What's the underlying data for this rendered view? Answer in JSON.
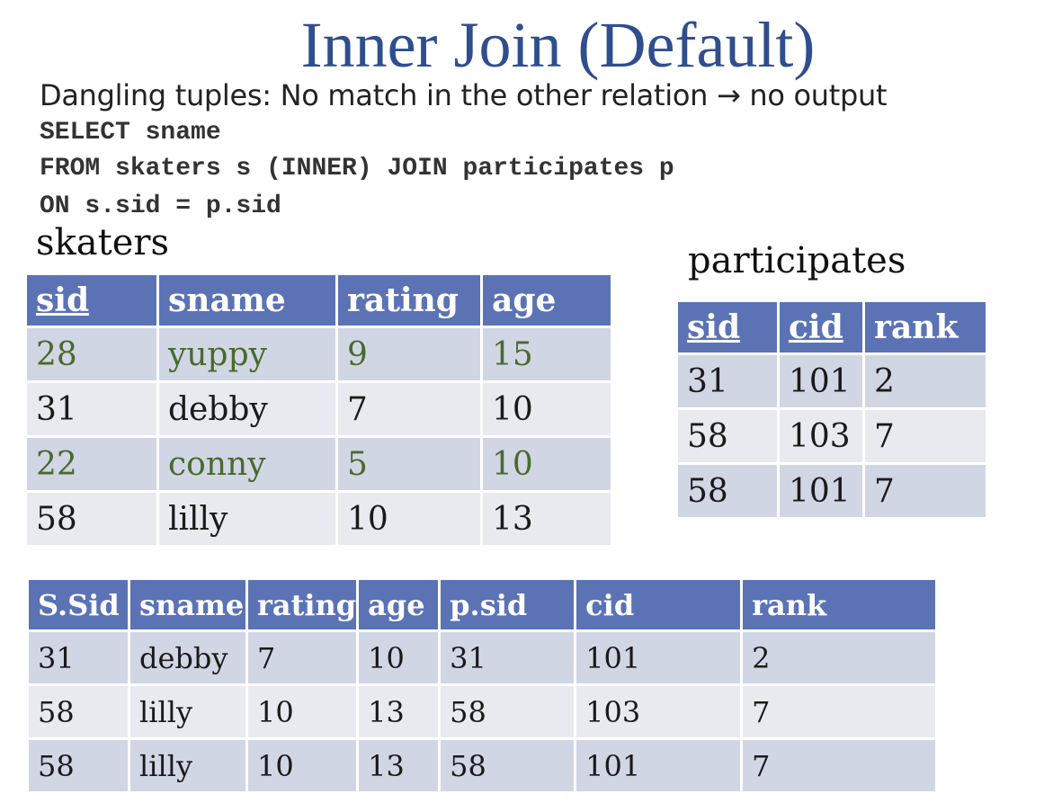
{
  "title": "Inner Join (Default)",
  "dangling_text": "Dangling tuples: No match in the other relation →  no output",
  "sql": [
    "SELECT sname",
    "FROM skaters s (INNER) JOIN participates p",
    "ON s.sid = p.sid"
  ],
  "skaters": {
    "label": "skaters",
    "headers": [
      "sid",
      "sname",
      "rating",
      "age"
    ],
    "rows": [
      [
        "28",
        "yuppy",
        "9",
        "15"
      ],
      [
        "31",
        "debby",
        "7",
        "10"
      ],
      [
        "22",
        "conny",
        "5",
        "10"
      ],
      [
        "58",
        "lilly",
        "10",
        "13"
      ]
    ]
  },
  "participates": {
    "label": "participates",
    "headers": [
      "sid",
      "cid",
      "rank"
    ],
    "rows": [
      [
        "31",
        "101",
        "2"
      ],
      [
        "58",
        "103",
        "7"
      ],
      [
        "58",
        "101",
        "7"
      ]
    ]
  },
  "result": {
    "headers": [
      "S.Sid",
      "sname",
      "rating",
      "age",
      "p.sid",
      "cid",
      "rank"
    ],
    "rows": [
      [
        "31",
        "debby",
        "7",
        "10",
        "31",
        "101",
        "2"
      ],
      [
        "58",
        "lilly",
        "10",
        "13",
        "58",
        "103",
        "7"
      ],
      [
        "58",
        "lilly",
        "10",
        "13",
        "58",
        "101",
        "7"
      ]
    ]
  },
  "colors": {
    "title": "#2f4e8e",
    "header_bg": "#5b73b5",
    "row_odd": "#d1d6e5",
    "row_even": "#e8eaf0",
    "dangling_text": "#4a6a2c"
  }
}
